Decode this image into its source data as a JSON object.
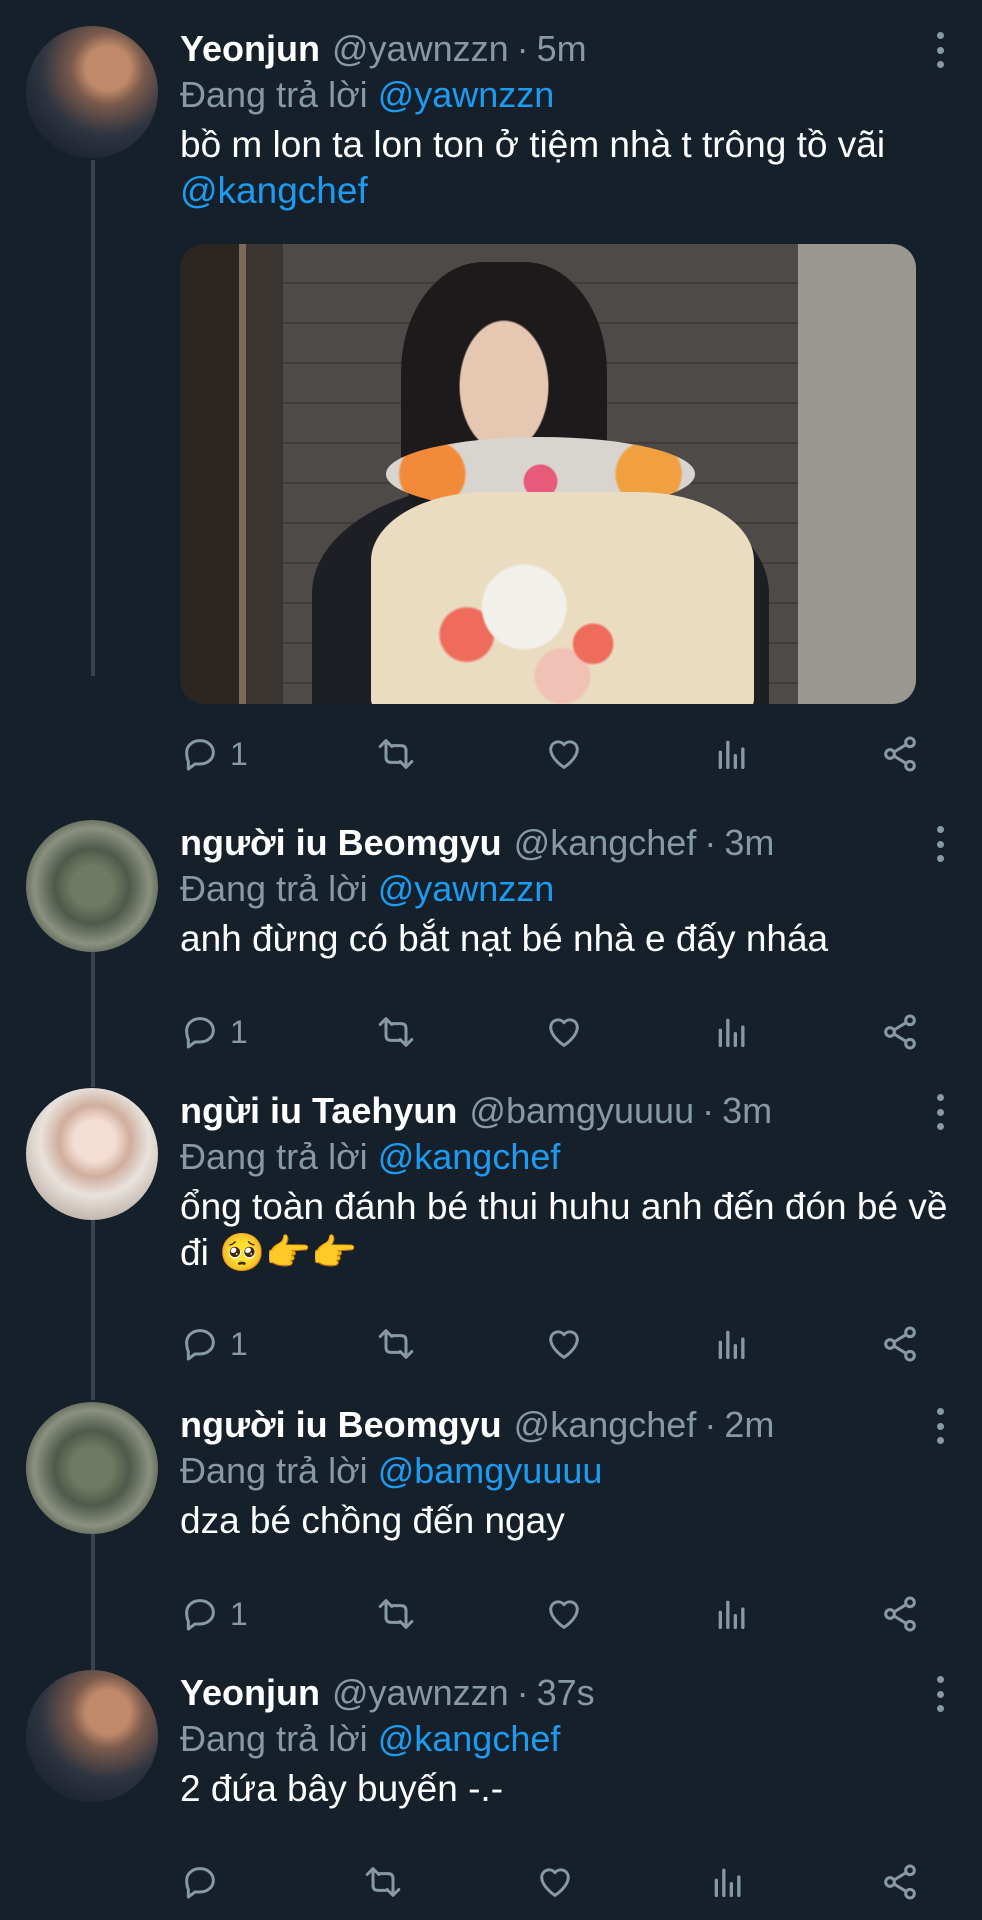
{
  "tweets": [
    {
      "name": "Yeonjun",
      "handle": "@yawnzzn",
      "time": "5m",
      "reply_label": "Đang trả lời",
      "reply_to": "@yawnzzn",
      "text": "bồ m lon ta lon ton ở tiệm nhà t trông tồ vãi",
      "text_mention": "@kangchef",
      "has_media": true,
      "reply_count": "1",
      "avatar": "yeonjun-avatar"
    },
    {
      "name": "người iu Beomgyu",
      "handle": "@kangchef",
      "time": "3m",
      "reply_label": "Đang trả lời",
      "reply_to": "@yawnzzn",
      "text": "anh đừng có bắt nạt bé nhà e đấy nháa",
      "reply_count": "1",
      "avatar": "beomgyu-avatar"
    },
    {
      "name": "ngừi iu Taehyun",
      "handle": "@bamgyuuuu",
      "time": "3m",
      "reply_label": "Đang trả lời",
      "reply_to": "@kangchef",
      "text": "ổng toàn đánh bé thui huhu anh đến đón bé về đi 🥺👉👉",
      "reply_count": "1",
      "avatar": "taehyun-avatar"
    },
    {
      "name": "người iu Beomgyu",
      "handle": "@kangchef",
      "time": "2m",
      "reply_label": "Đang trả lời",
      "reply_to": "@bamgyuuuu",
      "text": "dza bé chồng đến ngay",
      "reply_count": "1",
      "avatar": "beomgyu-avatar"
    },
    {
      "name": "Yeonjun",
      "handle": "@yawnzzn",
      "time": "37s",
      "reply_label": "Đang trả lời",
      "reply_to": "@kangchef",
      "text": "2 đứa bây buyến -.-",
      "reply_count": "",
      "avatar": "yeonjun-avatar"
    }
  ],
  "separator": "·",
  "colors": {
    "background": "#15202b",
    "secondary_text": "#8899a6",
    "mention": "#1d9bf0",
    "thread_line": "#38444d"
  },
  "icons": [
    "reply-icon",
    "retweet-icon",
    "like-icon",
    "analytics-icon",
    "share-icon",
    "more-icon"
  ]
}
